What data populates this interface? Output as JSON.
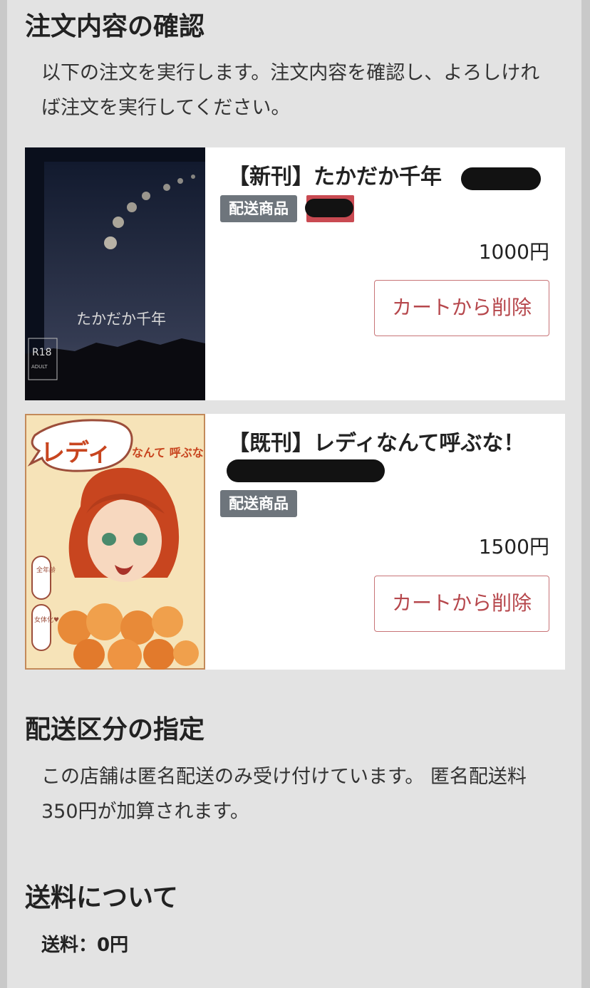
{
  "confirm": {
    "heading": "注文内容の確認",
    "instructions": "以下の注文を実行します。注文内容を確認し、よろしければ注文を実行してください。"
  },
  "items": [
    {
      "title": "【新刊】たかだか千年",
      "badge": "配送商品",
      "price": "1000円",
      "remove_label": "カートから削除",
      "cover_title": "たかだか千年",
      "cover_rating": "R18",
      "cover_rating_sub": "ADULT",
      "cover_colors": {
        "sky_top": "#121a2e",
        "sky_bottom": "#4d5163",
        "mountain": "#0b0b10"
      }
    },
    {
      "title": "【既刊】レディなんて呼ぶな！",
      "badge": "配送商品",
      "price": "1500円",
      "remove_label": "カートから削除",
      "cover_title_main": "レディ",
      "cover_title_sub": "なんて 呼ぶな！",
      "cover_tag1": "全年齢",
      "cover_tag2": "女体化♥",
      "cover_colors": {
        "background": "#f6e3b8",
        "hair": "#c8451f",
        "flowers": "#e88a38"
      }
    }
  ],
  "shipping_class": {
    "heading": "配送区分の指定",
    "text": "この店舗は匿名配送のみ受け付けています。 匿名配送料350円が加算されます。"
  },
  "shipping_fee": {
    "heading": "送料について",
    "line": "送料：0円"
  },
  "colors": {
    "page_bg": "#e3e3e3",
    "badge_bg": "#6e757c",
    "button_border": "#c87477",
    "button_text": "#b6474c"
  }
}
